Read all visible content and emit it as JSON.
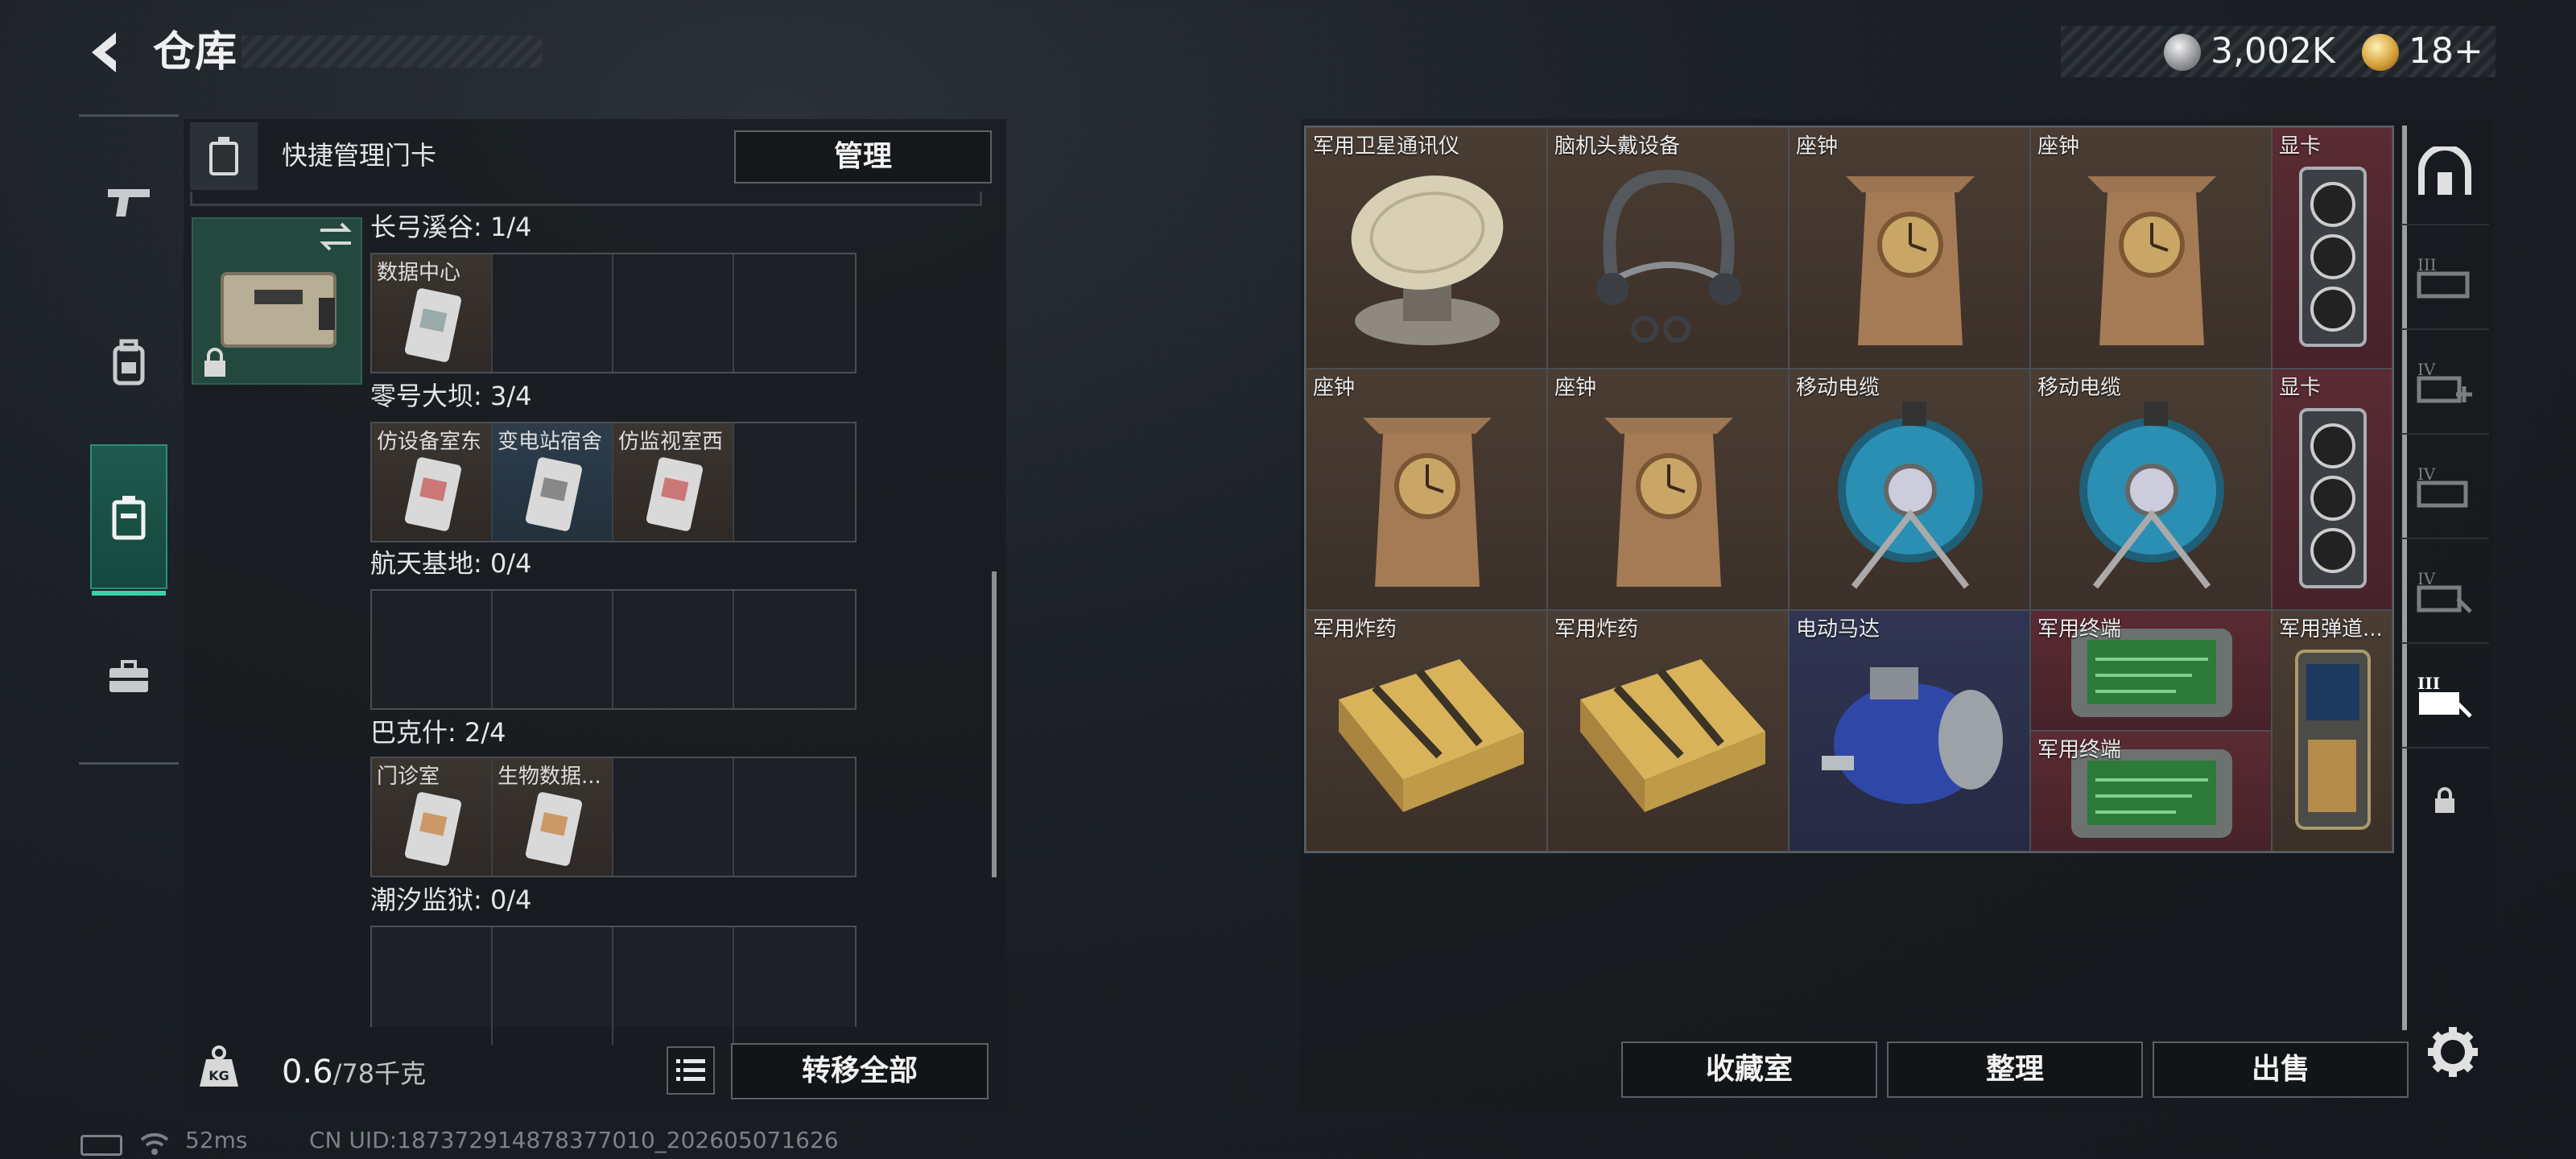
{
  "header": {
    "title": "仓库",
    "silver_amount": "3,002K",
    "gold_amount": "18+"
  },
  "left_panel": {
    "header_label": "快捷管理门卡",
    "manage_label": "管理",
    "maps": [
      {
        "label": "长弓溪谷: 1/4",
        "cards": [
          "数据中心",
          "",
          "",
          ""
        ]
      },
      {
        "label": "零号大坝: 3/4",
        "cards": [
          "仿设备室东",
          "变电站宿舍",
          "仿监视室西",
          ""
        ]
      },
      {
        "label": "航天基地: 0/4",
        "cards": [
          "",
          "",
          "",
          ""
        ]
      },
      {
        "label": "巴克什: 2/4",
        "cards": [
          "门诊室",
          "生物数据...",
          "",
          ""
        ]
      },
      {
        "label": "潮汐监狱: 0/4",
        "cards": [
          "",
          "",
          "",
          ""
        ]
      }
    ],
    "weight_value": "0.6",
    "weight_unit": "/78千克",
    "transfer_label": "转移全部"
  },
  "stash_items": [
    {
      "name": "军用卫星通讯仪",
      "rarity": "brown",
      "icon": "satellite-device"
    },
    {
      "name": "脑机头戴设备",
      "rarity": "brown",
      "icon": "headset"
    },
    {
      "name": "座钟",
      "rarity": "brown",
      "icon": "clock"
    },
    {
      "name": "座钟",
      "rarity": "brown",
      "icon": "clock"
    },
    {
      "name": "显卡",
      "rarity": "red",
      "icon": "gpu"
    },
    {
      "name": "座钟",
      "rarity": "brown",
      "icon": "clock"
    },
    {
      "name": "座钟",
      "rarity": "brown",
      "icon": "clock"
    },
    {
      "name": "移动电缆",
      "rarity": "brown",
      "icon": "cable-reel"
    },
    {
      "name": "移动电缆",
      "rarity": "brown",
      "icon": "cable-reel"
    },
    {
      "name": "显卡",
      "rarity": "red",
      "icon": "gpu"
    },
    {
      "name": "军用炸药",
      "rarity": "brown",
      "icon": "explosive"
    },
    {
      "name": "军用炸药",
      "rarity": "brown",
      "icon": "explosive"
    },
    {
      "name": "电动马达",
      "rarity": "blue",
      "icon": "motor"
    },
    {
      "name": "军用终端",
      "rarity": "red",
      "icon": "terminal"
    },
    {
      "name": "军用终端",
      "rarity": "red",
      "icon": "terminal"
    },
    {
      "name": "军用弹道...",
      "rarity": "brown",
      "icon": "ballistic-computer"
    }
  ],
  "buttons": {
    "collection": "收藏室",
    "sort": "整理",
    "sell": "出售"
  },
  "status": {
    "ping": "52ms",
    "uid": "CN UID:187372914878377010_202605071626"
  },
  "colors": {
    "accent": "#37d3a4",
    "rarity_brown": "#4a3d33",
    "rarity_red": "#5a2b33",
    "rarity_blue": "#303553"
  }
}
